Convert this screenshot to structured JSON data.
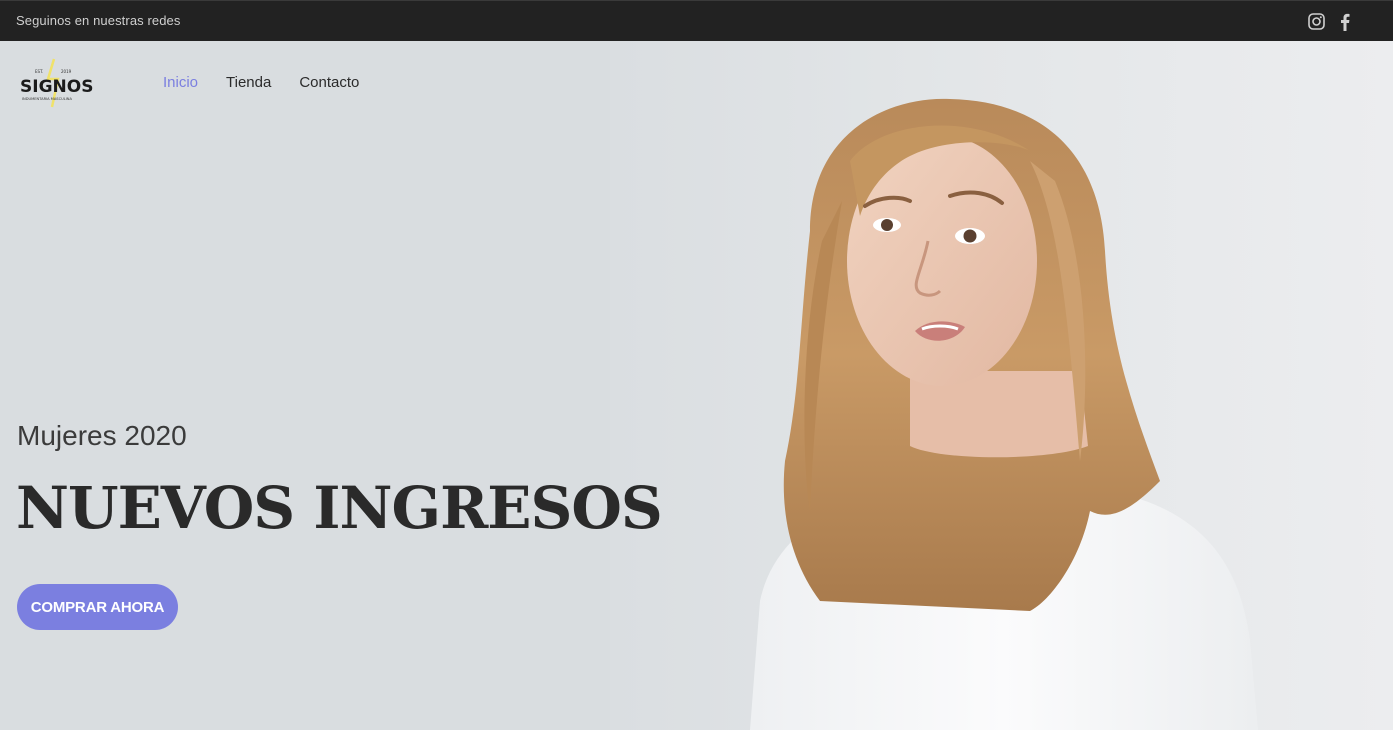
{
  "topbar": {
    "text": "Seguinos en nuestras redes",
    "social_icons": [
      "instagram-icon",
      "facebook-icon"
    ]
  },
  "logo": {
    "brand": "SIGNOS",
    "est_left": "EST.",
    "est_right": "2019",
    "tagline": "INDUMENTARIA MASCULINA"
  },
  "nav": {
    "items": [
      {
        "label": "Inicio",
        "active": true
      },
      {
        "label": "Tienda",
        "active": false
      },
      {
        "label": "Contacto",
        "active": false
      }
    ]
  },
  "hero": {
    "subtitle": "Mujeres 2020",
    "title": "NUEVOS INGRESOS",
    "cta_label": "COMPRAR AHORA"
  },
  "colors": {
    "accent": "#7b7fe0",
    "topbar_bg": "#222222",
    "hero_bg": "#d9dde0"
  }
}
